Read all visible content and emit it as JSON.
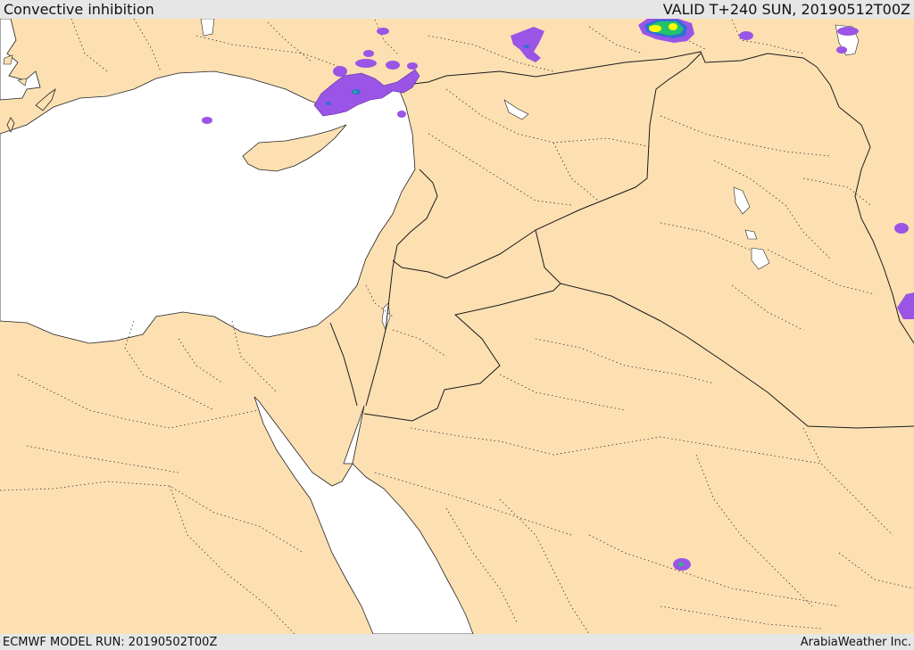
{
  "header": {
    "title": "Convective inhibition",
    "valid_time": "VALID T+240 SUN, 20190512T00Z"
  },
  "footer": {
    "model_run": "ECMWF MODEL RUN: 20190502T00Z",
    "credit": "ArabiaWeather Inc."
  },
  "colors": {
    "land": "#fde0b2",
    "water": "#ffffff",
    "cin_weak": "#9a55e6",
    "cin_moderate": "#2e6fd8",
    "cin_strong": "#22c26b",
    "cin_very_strong": "#ffff00"
  }
}
